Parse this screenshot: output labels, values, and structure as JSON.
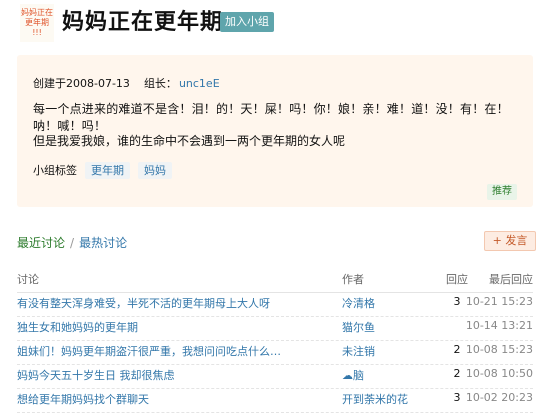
{
  "group": {
    "logo_lines": [
      "妈妈正在",
      "更年期",
      "!!!"
    ],
    "title": "妈妈正在更年期",
    "join_label": "加入小组"
  },
  "info": {
    "created_label": "创建于2008-07-13",
    "owner_prefix": "组长：",
    "owner_name": "unc1eE",
    "desc1": "每一个点进来的难道不是含！泪！的！天！屎！吗！你！娘！亲！难！道！没！有！在！呐！喊！吗！",
    "desc2": "但是我爱我娘，谁的生命中不会遇到一两个更年期的女人呢",
    "tags_label": "小组标签",
    "tags": [
      "更年期",
      "妈妈"
    ],
    "recommend_label": "推荐"
  },
  "discussion": {
    "tab_active": "最近讨论",
    "tab_sep": "/",
    "tab_other": "最热讨论",
    "post_label": "+ 发言",
    "columns": [
      "讨论",
      "作者",
      "回应",
      "最后回应"
    ],
    "rows": [
      {
        "title": "有没有整天浑身难受，半死不活的更年期母上大人呀",
        "author": "冷清格",
        "replies": "3",
        "time": "10-21 15:23"
      },
      {
        "title": "独生女和她妈妈的更年期",
        "author": "猫尔鱼",
        "replies": "",
        "time": "10-14 13:21"
      },
      {
        "title": "姐妹们！妈妈更年期盗汗很严重，我想问问吃点什么…",
        "author": "未注销",
        "replies": "2",
        "time": "10-08 15:23"
      },
      {
        "title": "妈妈今天五十岁生日 我却很焦虑",
        "author": "☁脑",
        "replies": "2",
        "time": "10-08 10:50"
      },
      {
        "title": "想给更年期妈妈找个群聊天",
        "author": "开到荼米的花",
        "replies": "3",
        "time": "10-02 20:23"
      }
    ]
  }
}
